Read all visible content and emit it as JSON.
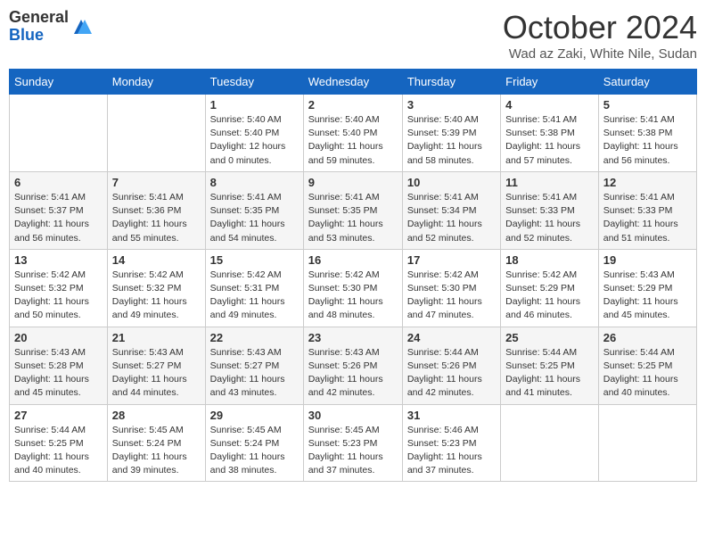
{
  "header": {
    "logo_general": "General",
    "logo_blue": "Blue",
    "month_title": "October 2024",
    "subtitle": "Wad az Zaki, White Nile, Sudan"
  },
  "weekdays": [
    "Sunday",
    "Monday",
    "Tuesday",
    "Wednesday",
    "Thursday",
    "Friday",
    "Saturday"
  ],
  "weeks": [
    [
      {
        "day": "",
        "info": ""
      },
      {
        "day": "",
        "info": ""
      },
      {
        "day": "1",
        "info": "Sunrise: 5:40 AM\nSunset: 5:40 PM\nDaylight: 12 hours and 0 minutes."
      },
      {
        "day": "2",
        "info": "Sunrise: 5:40 AM\nSunset: 5:40 PM\nDaylight: 11 hours and 59 minutes."
      },
      {
        "day": "3",
        "info": "Sunrise: 5:40 AM\nSunset: 5:39 PM\nDaylight: 11 hours and 58 minutes."
      },
      {
        "day": "4",
        "info": "Sunrise: 5:41 AM\nSunset: 5:38 PM\nDaylight: 11 hours and 57 minutes."
      },
      {
        "day": "5",
        "info": "Sunrise: 5:41 AM\nSunset: 5:38 PM\nDaylight: 11 hours and 56 minutes."
      }
    ],
    [
      {
        "day": "6",
        "info": "Sunrise: 5:41 AM\nSunset: 5:37 PM\nDaylight: 11 hours and 56 minutes."
      },
      {
        "day": "7",
        "info": "Sunrise: 5:41 AM\nSunset: 5:36 PM\nDaylight: 11 hours and 55 minutes."
      },
      {
        "day": "8",
        "info": "Sunrise: 5:41 AM\nSunset: 5:35 PM\nDaylight: 11 hours and 54 minutes."
      },
      {
        "day": "9",
        "info": "Sunrise: 5:41 AM\nSunset: 5:35 PM\nDaylight: 11 hours and 53 minutes."
      },
      {
        "day": "10",
        "info": "Sunrise: 5:41 AM\nSunset: 5:34 PM\nDaylight: 11 hours and 52 minutes."
      },
      {
        "day": "11",
        "info": "Sunrise: 5:41 AM\nSunset: 5:33 PM\nDaylight: 11 hours and 52 minutes."
      },
      {
        "day": "12",
        "info": "Sunrise: 5:41 AM\nSunset: 5:33 PM\nDaylight: 11 hours and 51 minutes."
      }
    ],
    [
      {
        "day": "13",
        "info": "Sunrise: 5:42 AM\nSunset: 5:32 PM\nDaylight: 11 hours and 50 minutes."
      },
      {
        "day": "14",
        "info": "Sunrise: 5:42 AM\nSunset: 5:32 PM\nDaylight: 11 hours and 49 minutes."
      },
      {
        "day": "15",
        "info": "Sunrise: 5:42 AM\nSunset: 5:31 PM\nDaylight: 11 hours and 49 minutes."
      },
      {
        "day": "16",
        "info": "Sunrise: 5:42 AM\nSunset: 5:30 PM\nDaylight: 11 hours and 48 minutes."
      },
      {
        "day": "17",
        "info": "Sunrise: 5:42 AM\nSunset: 5:30 PM\nDaylight: 11 hours and 47 minutes."
      },
      {
        "day": "18",
        "info": "Sunrise: 5:42 AM\nSunset: 5:29 PM\nDaylight: 11 hours and 46 minutes."
      },
      {
        "day": "19",
        "info": "Sunrise: 5:43 AM\nSunset: 5:29 PM\nDaylight: 11 hours and 45 minutes."
      }
    ],
    [
      {
        "day": "20",
        "info": "Sunrise: 5:43 AM\nSunset: 5:28 PM\nDaylight: 11 hours and 45 minutes."
      },
      {
        "day": "21",
        "info": "Sunrise: 5:43 AM\nSunset: 5:27 PM\nDaylight: 11 hours and 44 minutes."
      },
      {
        "day": "22",
        "info": "Sunrise: 5:43 AM\nSunset: 5:27 PM\nDaylight: 11 hours and 43 minutes."
      },
      {
        "day": "23",
        "info": "Sunrise: 5:43 AM\nSunset: 5:26 PM\nDaylight: 11 hours and 42 minutes."
      },
      {
        "day": "24",
        "info": "Sunrise: 5:44 AM\nSunset: 5:26 PM\nDaylight: 11 hours and 42 minutes."
      },
      {
        "day": "25",
        "info": "Sunrise: 5:44 AM\nSunset: 5:25 PM\nDaylight: 11 hours and 41 minutes."
      },
      {
        "day": "26",
        "info": "Sunrise: 5:44 AM\nSunset: 5:25 PM\nDaylight: 11 hours and 40 minutes."
      }
    ],
    [
      {
        "day": "27",
        "info": "Sunrise: 5:44 AM\nSunset: 5:25 PM\nDaylight: 11 hours and 40 minutes."
      },
      {
        "day": "28",
        "info": "Sunrise: 5:45 AM\nSunset: 5:24 PM\nDaylight: 11 hours and 39 minutes."
      },
      {
        "day": "29",
        "info": "Sunrise: 5:45 AM\nSunset: 5:24 PM\nDaylight: 11 hours and 38 minutes."
      },
      {
        "day": "30",
        "info": "Sunrise: 5:45 AM\nSunset: 5:23 PM\nDaylight: 11 hours and 37 minutes."
      },
      {
        "day": "31",
        "info": "Sunrise: 5:46 AM\nSunset: 5:23 PM\nDaylight: 11 hours and 37 minutes."
      },
      {
        "day": "",
        "info": ""
      },
      {
        "day": "",
        "info": ""
      }
    ]
  ]
}
